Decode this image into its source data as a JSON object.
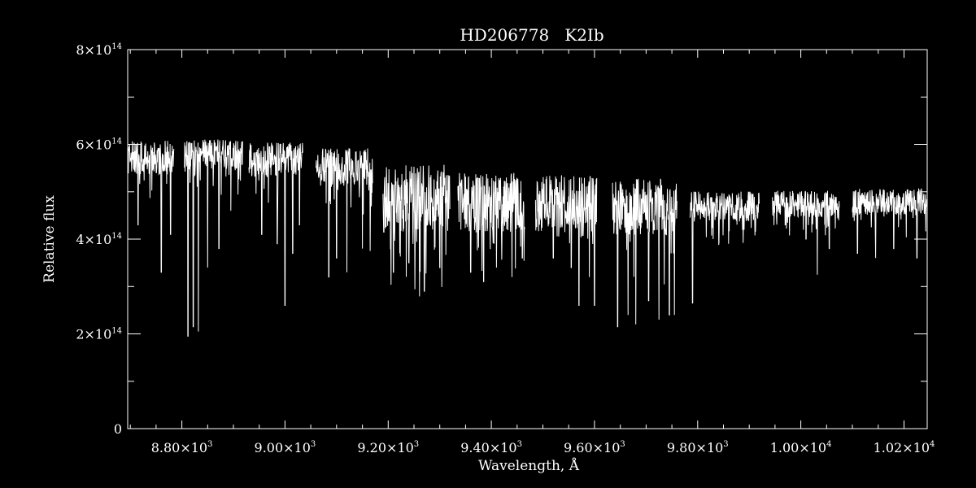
{
  "chart_data": {
    "type": "line",
    "title": "HD206778   K2Ib",
    "xlabel": "Wavelength, Å",
    "ylabel": "Relative flux",
    "xlim": [
      8695,
      10245
    ],
    "ylim": [
      0,
      800000000000000.0
    ],
    "x_ticks": [
      {
        "value": 8800,
        "mant": "8.80",
        "exp": "3"
      },
      {
        "value": 9000,
        "mant": "9.00",
        "exp": "3"
      },
      {
        "value": 9200,
        "mant": "9.20",
        "exp": "3"
      },
      {
        "value": 9400,
        "mant": "9.40",
        "exp": "3"
      },
      {
        "value": 9600,
        "mant": "9.60",
        "exp": "3"
      },
      {
        "value": 9800,
        "mant": "9.80",
        "exp": "3"
      },
      {
        "value": 10000,
        "mant": "1.00",
        "exp": "4"
      },
      {
        "value": 10200,
        "mant": "1.02",
        "exp": "4"
      }
    ],
    "y_ticks": [
      {
        "value": 0,
        "mant": "0",
        "exp": ""
      },
      {
        "value": 200000000000000.0,
        "mant": "2",
        "exp": "14"
      },
      {
        "value": 400000000000000.0,
        "mant": "4",
        "exp": "14"
      },
      {
        "value": 600000000000000.0,
        "mant": "6",
        "exp": "14"
      },
      {
        "value": 800000000000000.0,
        "mant": "8",
        "exp": "14"
      }
    ],
    "times_sign": "×",
    "ten": "10",
    "segments": [
      {
        "x_start": 8695,
        "x_end": 8785,
        "continuum": 580000000000000.0,
        "noise": 45000000000000.0,
        "lines": [
          [
            8715,
            430000000000000.0
          ],
          [
            8760,
            330000000000000.0
          ],
          [
            8778,
            410000000000000.0
          ]
        ]
      },
      {
        "x_start": 8805,
        "x_end": 8918,
        "continuum": 585000000000000.0,
        "noise": 40000000000000.0,
        "lines": [
          [
            8812,
            195000000000000.0
          ],
          [
            8822,
            215000000000000.0
          ],
          [
            8832,
            205000000000000.0
          ],
          [
            8850,
            340000000000000.0
          ],
          [
            8872,
            380000000000000.0
          ],
          [
            8895,
            460000000000000.0
          ]
        ]
      },
      {
        "x_start": 8930,
        "x_end": 9035,
        "continuum": 575000000000000.0,
        "noise": 45000000000000.0,
        "lines": [
          [
            8955,
            410000000000000.0
          ],
          [
            8985,
            390000000000000.0
          ],
          [
            9000,
            260000000000000.0
          ],
          [
            9015,
            370000000000000.0
          ],
          [
            9028,
            430000000000000.0
          ]
        ]
      },
      {
        "x_start": 9060,
        "x_end": 9170,
        "continuum": 560000000000000.0,
        "noise": 50000000000000.0,
        "lines": [
          [
            9085,
            320000000000000.0
          ],
          [
            9100,
            360000000000000.0
          ],
          [
            9120,
            330000000000000.0
          ],
          [
            9150,
            380000000000000.0
          ],
          [
            9165,
            375000000000000.0
          ]
        ]
      },
      {
        "x_start": 9190,
        "x_end": 9320,
        "continuum": 500000000000000.0,
        "noise": 90000000000000.0,
        "lines": [
          [
            9210,
            330000000000000.0
          ],
          [
            9240,
            350000000000000.0
          ],
          [
            9270,
            290000000000000.0
          ],
          [
            9300,
            340000000000000.0
          ]
        ]
      },
      {
        "x_start": 9335,
        "x_end": 9465,
        "continuum": 490000000000000.0,
        "noise": 80000000000000.0,
        "lines": [
          [
            9360,
            330000000000000.0
          ],
          [
            9385,
            310000000000000.0
          ],
          [
            9410,
            340000000000000.0
          ],
          [
            9440,
            320000000000000.0
          ],
          [
            9460,
            360000000000000.0
          ]
        ]
      },
      {
        "x_start": 9485,
        "x_end": 9605,
        "continuum": 490000000000000.0,
        "noise": 70000000000000.0,
        "lines": [
          [
            9520,
            360000000000000.0
          ],
          [
            9555,
            340000000000000.0
          ],
          [
            9570,
            260000000000000.0
          ],
          [
            9590,
            320000000000000.0
          ],
          [
            9600,
            260000000000000.0
          ]
        ]
      },
      {
        "x_start": 9635,
        "x_end": 9760,
        "continuum": 480000000000000.0,
        "noise": 75000000000000.0,
        "lines": [
          [
            9645,
            215000000000000.0
          ],
          [
            9665,
            240000000000000.0
          ],
          [
            9680,
            220000000000000.0
          ],
          [
            9705,
            270000000000000.0
          ],
          [
            9725,
            230000000000000.0
          ],
          [
            9745,
            240000000000000.0
          ],
          [
            9755,
            240000000000000.0
          ]
        ]
      },
      {
        "x_start": 9785,
        "x_end": 9920,
        "continuum": 475000000000000.0,
        "noise": 40000000000000.0,
        "lines": [
          [
            9790,
            265000000000000.0
          ],
          [
            9830,
            400000000000000.0
          ],
          [
            9860,
            390000000000000.0
          ],
          [
            9890,
            420000000000000.0
          ]
        ]
      },
      {
        "x_start": 9945,
        "x_end": 10075,
        "continuum": 480000000000000.0,
        "noise": 35000000000000.0,
        "lines": [
          [
            9970,
            430000000000000.0
          ],
          [
            10010,
            400000000000000.0
          ],
          [
            10032,
            325000000000000.0
          ],
          [
            10055,
            380000000000000.0
          ]
        ]
      },
      {
        "x_start": 10100,
        "x_end": 10245,
        "continuum": 485000000000000.0,
        "noise": 35000000000000.0,
        "lines": [
          [
            10110,
            370000000000000.0
          ],
          [
            10145,
            360000000000000.0
          ],
          [
            10180,
            380000000000000.0
          ],
          [
            10225,
            360000000000000.0
          ]
        ]
      }
    ]
  }
}
